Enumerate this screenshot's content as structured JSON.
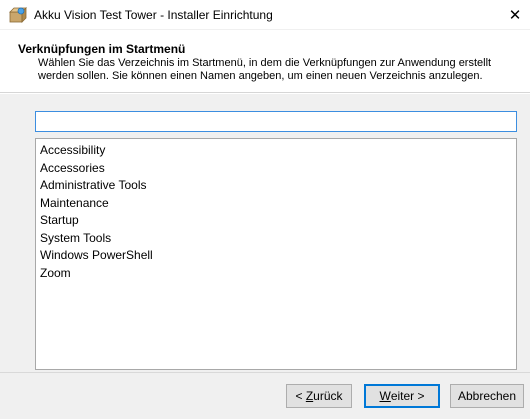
{
  "window": {
    "title": "Akku Vision Test Tower - Installer Einrichtung",
    "close_glyph": "✕",
    "app_icon": "installer-icon"
  },
  "header": {
    "title": "Verknüpfungen im Startmenü",
    "description": "Wählen Sie das Verzeichnis im Startmenü, in dem die Verknüpfungen zur Anwendung erstellt werden sollen. Sie können einen Namen angeben, um einen neuen Verzeichnis anzulegen."
  },
  "folder_name_input": {
    "value": ""
  },
  "folders": [
    "Accessibility",
    "Accessories",
    "Administrative Tools",
    "Maintenance",
    "Startup",
    "System Tools",
    "Windows PowerShell",
    "Zoom"
  ],
  "buttons": {
    "back_prefix": "< ",
    "back_mnemonic": "Z",
    "back_rest": "urück",
    "next_mnemonic": "W",
    "next_rest": "eiter >",
    "cancel": "Abbrechen"
  },
  "colors": {
    "focus_accent": "#0078d7",
    "input_border": "#3c8ee0",
    "panel_background": "#f0f0f0"
  }
}
